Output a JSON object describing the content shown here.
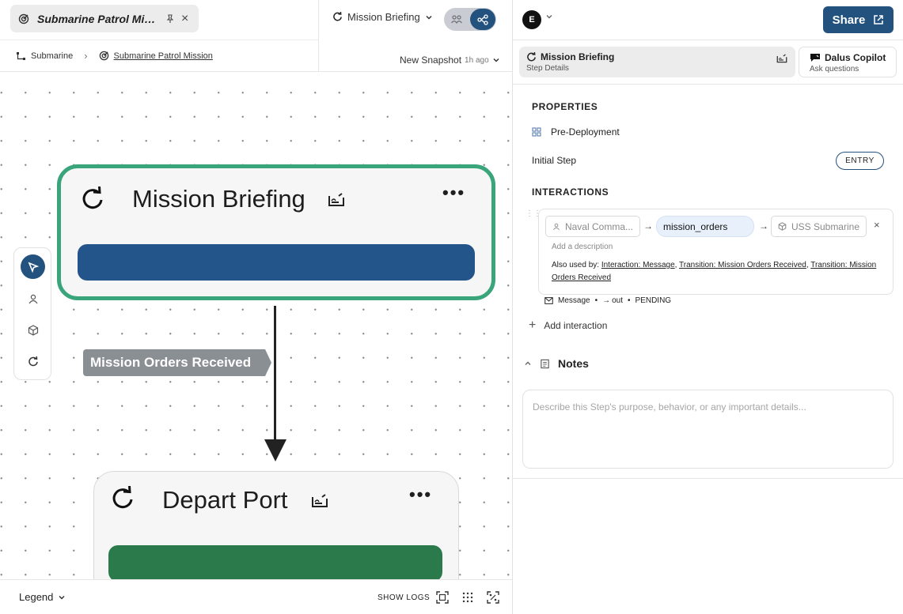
{
  "left": {
    "tab": {
      "title": "Submarine Patrol Mission"
    },
    "step_selector": {
      "label": "Mission Briefing"
    },
    "breadcrumb": {
      "root": "Submarine",
      "current": "Submarine Patrol Mission"
    },
    "snapshot": {
      "label": "New Snapshot",
      "ago": "1h ago"
    },
    "canvas": {
      "nodes": [
        {
          "title": "Mission Briefing",
          "bar_color": "#23548a",
          "border_color": "#3aa57a"
        },
        {
          "title": "Depart Port",
          "bar_color": "#2a7a4c"
        }
      ],
      "edge_label": "Mission Orders Received"
    },
    "bottom": {
      "legend": "Legend",
      "show_logs": "SHOW LOGS"
    }
  },
  "right": {
    "avatar": "E",
    "share": "Share",
    "tabs": [
      {
        "title": "Mission Briefing",
        "subtitle": "Step Details"
      },
      {
        "title": "Dalus Copilot",
        "subtitle": "Ask questions"
      }
    ],
    "properties": {
      "heading": "PROPERTIES",
      "phase": "Pre-Deployment",
      "initial_step_label": "Initial Step",
      "initial_step_badge": "ENTRY"
    },
    "interactions": {
      "heading": "INTERACTIONS",
      "items": [
        {
          "source": "Naval Comma...",
          "message": "mission_orders",
          "target": "USS Submarine",
          "description_placeholder": "Add a description",
          "also_used_prefix": "Also used by:",
          "also_used": [
            "Interaction: Message",
            "Transition: Mission Orders Received",
            "Transition: Mission Orders Received"
          ],
          "meta_type": "Message",
          "meta_dir": "out",
          "meta_status": "PENDING"
        }
      ],
      "add_label": "Add interaction"
    },
    "notes": {
      "heading": "Notes",
      "placeholder": "Describe this Step's purpose, behavior, or any important details..."
    }
  },
  "colors": {
    "accent": "#23527f",
    "node_selected_border": "#3aa57a"
  }
}
